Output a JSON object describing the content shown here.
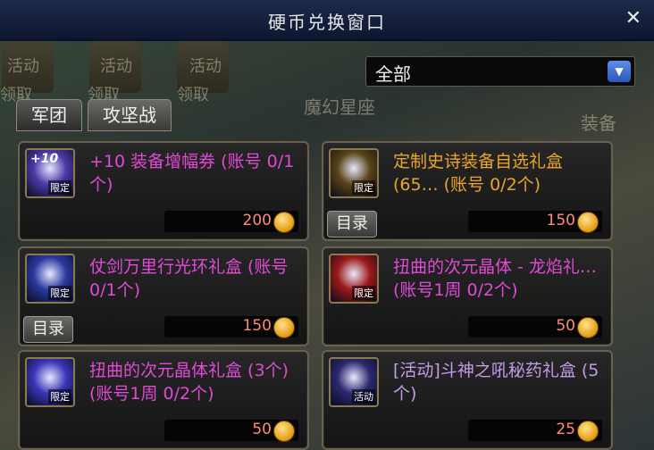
{
  "window": {
    "title": "硬币兑换窗口",
    "close_glyph": "✕"
  },
  "filter": {
    "selected": "全部",
    "arrow_glyph": "▼"
  },
  "tabs": [
    {
      "label": "军团"
    },
    {
      "label": "攻坚战"
    }
  ],
  "items": [
    {
      "name": "+10 装备增幅券 (账号 0/1个)",
      "name_color": "#e04ad6",
      "price": "200",
      "badge": "限定",
      "icon_text": "+10",
      "icon_color": "#4a3aa8",
      "has_catalog": false
    },
    {
      "name": "定制史诗装备自选礼盒 (65… (账号 0/2个)",
      "name_color": "#eaa62a",
      "price": "150",
      "badge": "限定",
      "icon_text": "",
      "icon_color": "#5a4418",
      "has_catalog": true
    },
    {
      "name": "仗剑万里行光环礼盒 (账号 0/1个)",
      "name_color": "#e04ad6",
      "price": "150",
      "badge": "限定",
      "icon_text": "",
      "icon_color": "#2a3aa0",
      "has_catalog": true
    },
    {
      "name": "扭曲的次元晶体 - 龙焰礼… (账号1周 0/2个)",
      "name_color": "#e04ad6",
      "price": "50",
      "badge": "限定",
      "icon_text": "",
      "icon_color": "#9a1a1a",
      "has_catalog": false
    },
    {
      "name": "扭曲的次元晶体礼盒 (3个) (账号1周 0/2个)",
      "name_color": "#e04ad6",
      "price": "50",
      "badge": "限定",
      "icon_text": "",
      "icon_color": "#3a36b8",
      "has_catalog": false
    },
    {
      "name": "[活动]斗神之吼秘药礼盒 (5个)",
      "name_color": "#c39be6",
      "price": "25",
      "badge": "活动",
      "icon_text": "",
      "icon_color": "#2a2a70",
      "has_catalog": false
    }
  ],
  "catalog_label": "目录",
  "background": {
    "slot_labels": [
      "活动",
      "活动",
      "活动"
    ],
    "side_labels": [
      "领取",
      "领取",
      "领取"
    ],
    "map_label": "魔幻星座",
    "right_label": "装备"
  }
}
